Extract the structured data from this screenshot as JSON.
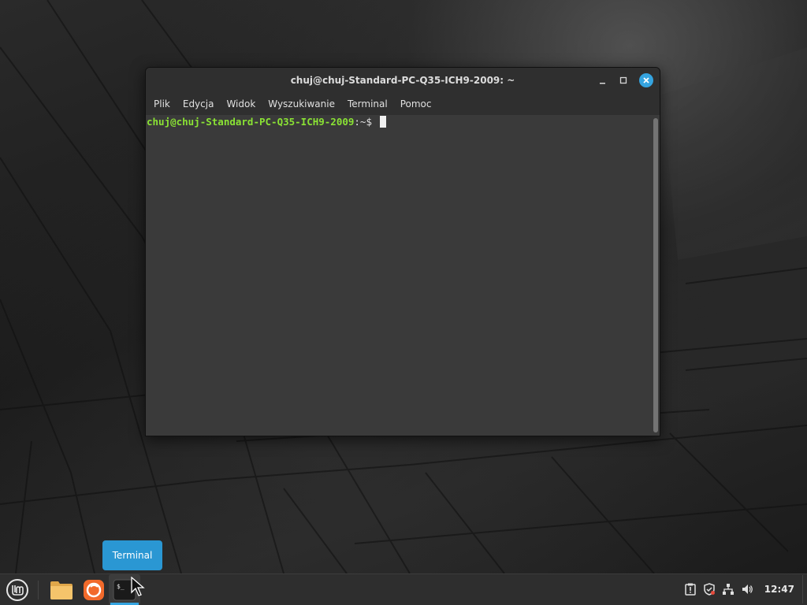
{
  "window": {
    "title": "chuj@chuj-Standard-PC-Q35-ICH9-2009: ~",
    "menu": [
      "Plik",
      "Edycja",
      "Widok",
      "Wyszukiwanie",
      "Terminal",
      "Pomoc"
    ],
    "terminal": {
      "prompt_user_host": "chuj@chuj-Standard-PC-Q35-ICH9-2009",
      "prompt_path": ":~$ "
    }
  },
  "tooltip": {
    "label": "Terminal"
  },
  "taskbar": {
    "launchers": [
      {
        "name": "files",
        "icon": "folder-icon"
      },
      {
        "name": "firefox",
        "icon": "firefox-icon"
      },
      {
        "name": "terminal",
        "icon": "terminal-icon",
        "icon_text": "$_",
        "active": true
      }
    ],
    "tray_icons": [
      "update-manager-icon",
      "shield-icon",
      "network-icon",
      "volume-icon"
    ],
    "clock": "12:47"
  },
  "colors": {
    "accent": "#35a4e0",
    "prompt_green": "#8ae234",
    "terminal_bg": "#3a3a3a"
  }
}
